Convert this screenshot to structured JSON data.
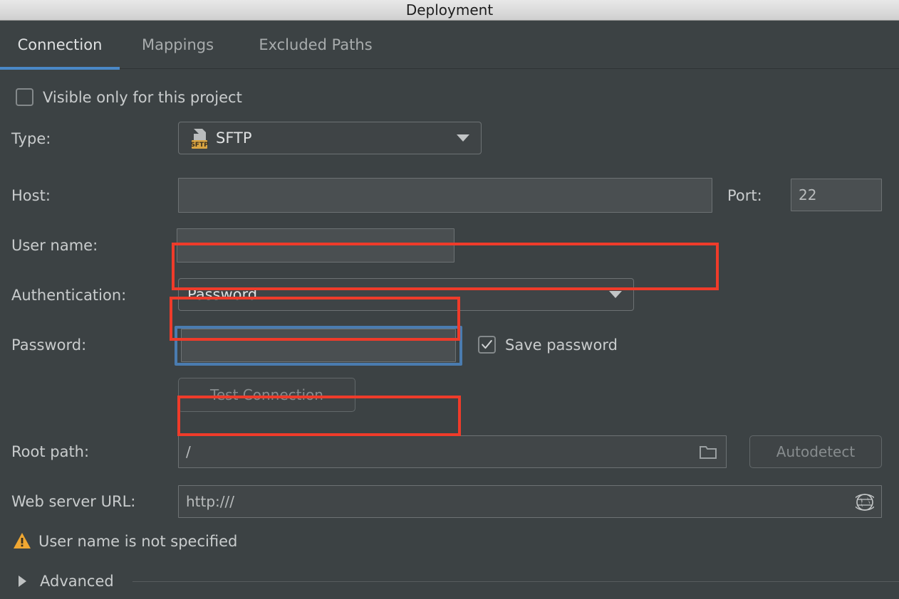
{
  "window": {
    "title": "Deployment"
  },
  "tabs": [
    {
      "label": "Connection",
      "active": true
    },
    {
      "label": "Mappings",
      "active": false
    },
    {
      "label": "Excluded Paths",
      "active": false
    }
  ],
  "form": {
    "visible_only_checkbox": {
      "label": "Visible only for this project",
      "checked": false
    },
    "type": {
      "label": "Type:",
      "value": "SFTP",
      "icon": "sftp-file-icon",
      "badge_text": "SFTP"
    },
    "host": {
      "label": "Host:",
      "value": "",
      "placeholder": ""
    },
    "port": {
      "label": "Port:",
      "value": "22"
    },
    "user_name": {
      "label": "User name:",
      "value": ""
    },
    "authentication": {
      "label": "Authentication:",
      "value": "Password"
    },
    "password": {
      "label": "Password:",
      "value": ""
    },
    "save_password": {
      "label": "Save password",
      "checked": true
    },
    "test_connection": {
      "label": "Test Connection",
      "enabled": false
    },
    "root_path": {
      "label": "Root path:",
      "value": "/",
      "browse_icon": "folder-icon"
    },
    "autodetect": {
      "label": "Autodetect",
      "enabled": false
    },
    "web_server_url": {
      "label": "Web server URL:",
      "value": "http:///",
      "open_icon": "globe-icon"
    },
    "validation": {
      "icon": "warning-triangle-icon",
      "message": "User name is not specified"
    },
    "advanced": {
      "label": "Advanced",
      "expanded": false,
      "icon": "chevron-right-icon"
    }
  },
  "colors": {
    "background": "#3c4244",
    "accent_tab": "#4a88c7",
    "annotation": "#ef3b2a",
    "focus_ring": "#4a7cb0",
    "warning": "#f0a732",
    "sftp_badge": "#d9a441"
  }
}
